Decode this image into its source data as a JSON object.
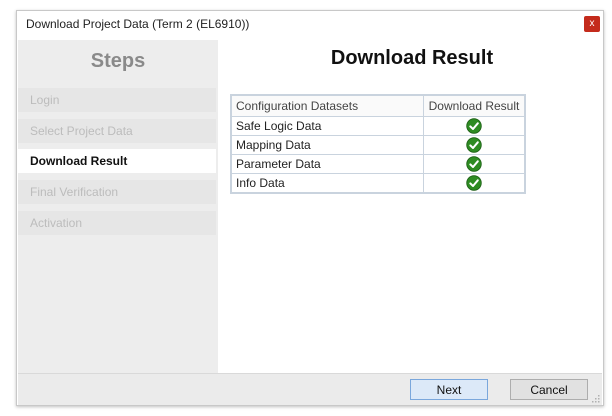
{
  "window": {
    "title": "Download Project Data (Term 2 (EL6910))",
    "close_glyph": "x"
  },
  "sidebar": {
    "heading": "Steps",
    "steps": [
      {
        "label": "Login",
        "active": false
      },
      {
        "label": "Select Project Data",
        "active": false
      },
      {
        "label": "Download Result",
        "active": true
      },
      {
        "label": "Final Verification",
        "active": false
      },
      {
        "label": "Activation",
        "active": false
      }
    ]
  },
  "main": {
    "heading": "Download Result",
    "table": {
      "headers": [
        "Configuration Datasets",
        "Download Result"
      ],
      "rows": [
        {
          "dataset": "Safe Logic Data",
          "result": "success-check-icon"
        },
        {
          "dataset": "Mapping Data",
          "result": "success-check-icon"
        },
        {
          "dataset": "Parameter Data",
          "result": "success-check-icon"
        },
        {
          "dataset": "Info Data",
          "result": "success-check-icon"
        }
      ]
    }
  },
  "footer": {
    "next_label": "Next",
    "cancel_label": "Cancel"
  },
  "colors": {
    "close": "#c42b1c",
    "success": "#2e8b22",
    "next_bg": "#dce9f8"
  }
}
